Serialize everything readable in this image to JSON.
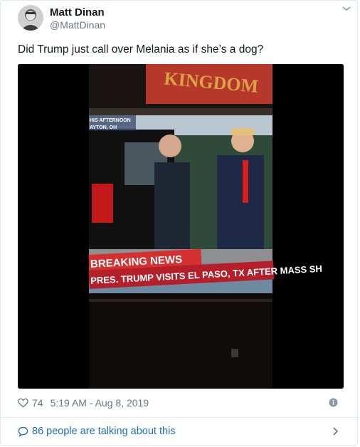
{
  "tweet": {
    "author_name": "Matt Dinan",
    "author_handle": "@MattDinan",
    "text": "Did Trump just call over Melania as if she’s a dog?",
    "likes": "74",
    "timestamp": "5:19 AM - Aug 8, 2019",
    "talking_text": "86 people are talking about this"
  },
  "media": {
    "banner_top": "HIS AFTERNOON",
    "banner_place": "AYTON, OH",
    "breaking_label": "BREAKING NEWS",
    "headline": "PRES. TRUMP VISITS EL PASO, TX AFTER MASS SH",
    "sign_text": "KINGDOM"
  },
  "icons": {
    "caret": "chevron-down-icon",
    "like": "heart-icon",
    "info": "info-icon",
    "conversation": "speech-bubble-icon",
    "more": "chevron-right-icon"
  },
  "colors": {
    "link": "#1b6fb5",
    "muted": "#657786",
    "breaking_red": "#d52f2f"
  }
}
